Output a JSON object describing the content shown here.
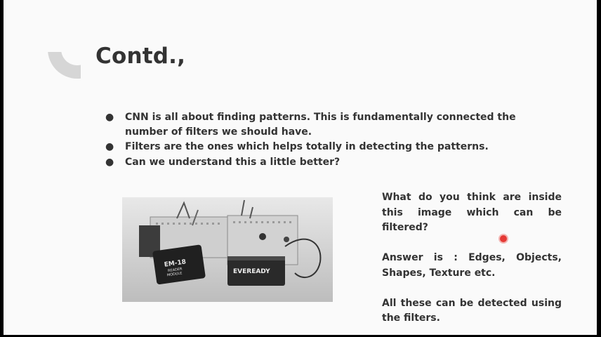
{
  "slide": {
    "title": "Contd.,",
    "bullets": [
      {
        "marker": "●",
        "text": "CNN is all about finding patterns. This is fundamentally connected the number of filters we should have."
      },
      {
        "marker": "●",
        "text": "Filters are the ones which helps totally in detecting the patterns."
      },
      {
        "marker": "●",
        "text": "Can we understand this a little better?"
      }
    ],
    "image": {
      "module_label_line1": "EM-18",
      "module_label_line2": "READER",
      "module_label_line3": "MODULE",
      "battery_label": "EVEREADY"
    },
    "side_text": {
      "question": "What do you think are inside this image which can be filtered?",
      "answer": "Answer is : Edges, Objects, Shapes, Texture etc.",
      "conclusion": "All these can be detected using the filters."
    }
  },
  "colors": {
    "text": "#333333",
    "background": "#fafafa",
    "frame": "#000000",
    "decoration": "#d6d6d6",
    "pointer": "#e53935"
  },
  "icons": {
    "bullet": "bullet-dot-icon",
    "pointer": "laser-pointer-icon"
  }
}
